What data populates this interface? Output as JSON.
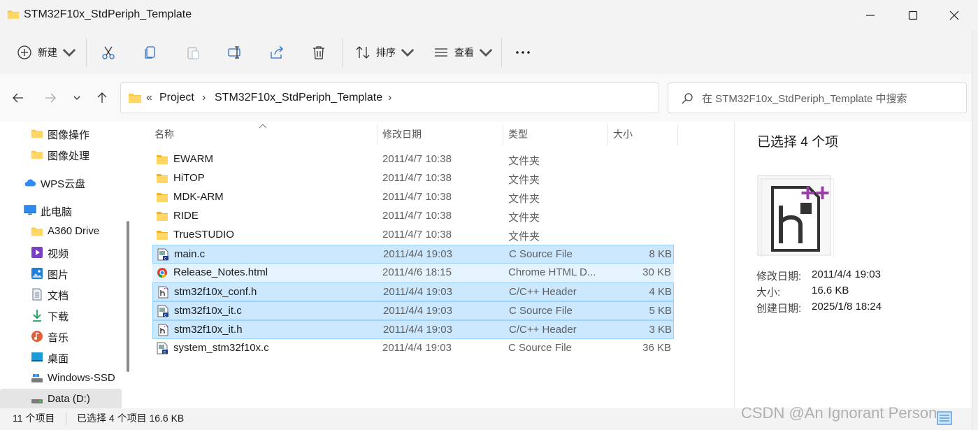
{
  "window": {
    "title": "STM32F10x_StdPeriph_Template"
  },
  "toolbar": {
    "new_label": "新建",
    "sort_label": "排序",
    "view_label": "查看"
  },
  "address": {
    "overflow": "«",
    "crumbs": [
      "Project",
      "STM32F10x_StdPeriph_Template"
    ]
  },
  "search": {
    "placeholder": "在 STM32F10x_StdPeriph_Template 中搜索"
  },
  "sidebar": {
    "items": [
      {
        "label": "图像操作",
        "icon": "folder-icon"
      },
      {
        "label": "图像处理",
        "icon": "folder-icon"
      },
      {
        "label": "WPS云盘",
        "icon": "cloud-icon"
      },
      {
        "label": "此电脑",
        "icon": "computer-icon"
      },
      {
        "label": "A360 Drive",
        "icon": "folder-icon"
      },
      {
        "label": "视频",
        "icon": "video-icon"
      },
      {
        "label": "图片",
        "icon": "picture-icon"
      },
      {
        "label": "文档",
        "icon": "document-icon"
      },
      {
        "label": "下载",
        "icon": "download-icon"
      },
      {
        "label": "音乐",
        "icon": "music-icon"
      },
      {
        "label": "桌面",
        "icon": "desktop-icon"
      },
      {
        "label": "Windows-SSD",
        "icon": "drive-icon"
      },
      {
        "label": "Data (D:)",
        "icon": "drive-icon"
      }
    ]
  },
  "columns": {
    "name": "名称",
    "date": "修改日期",
    "type": "类型",
    "size": "大小"
  },
  "files": [
    {
      "name": "EWARM",
      "date": "2011/4/7 10:38",
      "type": "文件夹",
      "size": "",
      "icon": "folder-icon",
      "state": ""
    },
    {
      "name": "HiTOP",
      "date": "2011/4/7 10:38",
      "type": "文件夹",
      "size": "",
      "icon": "folder-icon",
      "state": ""
    },
    {
      "name": "MDK-ARM",
      "date": "2011/4/7 10:38",
      "type": "文件夹",
      "size": "",
      "icon": "folder-icon",
      "state": ""
    },
    {
      "name": "RIDE",
      "date": "2011/4/7 10:38",
      "type": "文件夹",
      "size": "",
      "icon": "folder-icon",
      "state": ""
    },
    {
      "name": "TrueSTUDIO",
      "date": "2011/4/7 10:38",
      "type": "文件夹",
      "size": "",
      "icon": "folder-icon",
      "state": ""
    },
    {
      "name": "main.c",
      "date": "2011/4/4 19:03",
      "type": "C Source File",
      "size": "8 KB",
      "icon": "c-file-icon",
      "state": "sel"
    },
    {
      "name": "Release_Notes.html",
      "date": "2011/4/6 18:15",
      "type": "Chrome HTML D...",
      "size": "30 KB",
      "icon": "chrome-icon",
      "state": "hover"
    },
    {
      "name": "stm32f10x_conf.h",
      "date": "2011/4/4 19:03",
      "type": "C/C++ Header",
      "size": "4 KB",
      "icon": "h-file-icon",
      "state": "sel"
    },
    {
      "name": "stm32f10x_it.c",
      "date": "2011/4/4 19:03",
      "type": "C Source File",
      "size": "5 KB",
      "icon": "c-file-icon",
      "state": "sel"
    },
    {
      "name": "stm32f10x_it.h",
      "date": "2011/4/4 19:03",
      "type": "C/C++ Header",
      "size": "3 KB",
      "icon": "h-file-icon",
      "state": "sel"
    },
    {
      "name": "system_stm32f10x.c",
      "date": "2011/4/4 19:03",
      "type": "C Source File",
      "size": "36 KB",
      "icon": "c-file-icon",
      "state": ""
    }
  ],
  "details": {
    "title": "已选择 4 个项",
    "modified_label": "修改日期:",
    "modified_value": "2011/4/4 19:03",
    "size_label": "大小:",
    "size_value": "16.6 KB",
    "created_label": "创建日期:",
    "created_value": "2025/1/8 18:24"
  },
  "status": {
    "count": "11 个项目",
    "selection": "已选择 4 个项目  16.6 KB"
  },
  "watermark": "CSDN @An Ignorant Person",
  "colors": {
    "selection": "#cce8ff",
    "selection_border": "#99d1ff",
    "hover": "#e5f3ff",
    "folder": "#f8c94a"
  }
}
